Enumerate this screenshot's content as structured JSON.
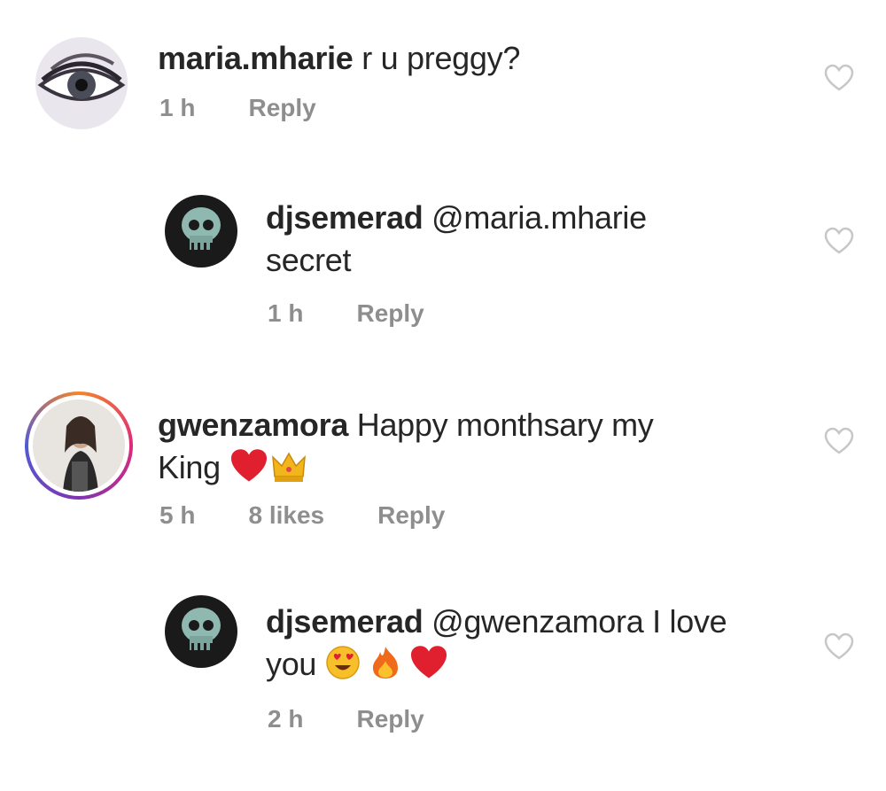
{
  "comments": [
    {
      "username": "maria.mharie",
      "text": "r u preggy?",
      "time": "1 h",
      "reply_label": "Reply",
      "avatar_icon": "eye-avatar"
    },
    {
      "username": "djsemerad",
      "mention": "@maria.mharie",
      "text": "secret",
      "time": "1 h",
      "reply_label": "Reply",
      "avatar_icon": "skull-avatar"
    },
    {
      "username": "gwenzamora",
      "text_line1": "Happy monthsary my",
      "text_line2": "King",
      "emojis": [
        "red-heart",
        "crown"
      ],
      "time": "5 h",
      "likes": "8 likes",
      "reply_label": "Reply",
      "avatar_icon": "woman-avatar"
    },
    {
      "username": "djsemerad",
      "mention": "@gwenzamora",
      "text_line1": "I love",
      "text_line2": "you",
      "emojis": [
        "heart-eyes-face",
        "fire",
        "red-heart"
      ],
      "time": "2 h",
      "reply_label": "Reply",
      "avatar_icon": "skull-avatar"
    }
  ],
  "colors": {
    "text": "#262626",
    "meta": "#8e8e8e",
    "heart_outline": "#c7c7c7",
    "story_ring": "#e1306c"
  }
}
